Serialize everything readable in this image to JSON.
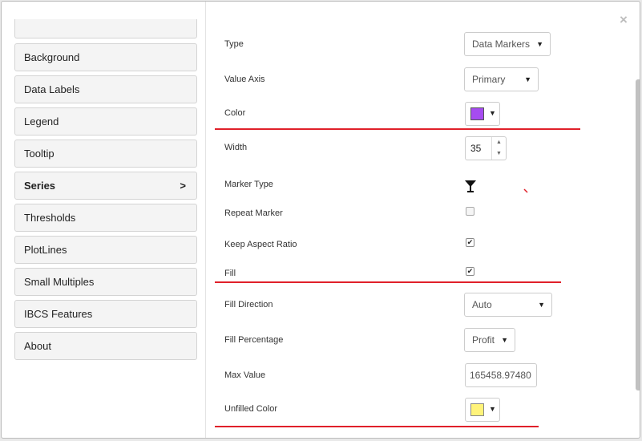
{
  "dialog": {
    "close_glyph": "×"
  },
  "sidebar": {
    "items": [
      {
        "label": "Background"
      },
      {
        "label": "Data Labels"
      },
      {
        "label": "Legend"
      },
      {
        "label": "Tooltip"
      },
      {
        "label": "Series",
        "active": true,
        "arrow": ">"
      },
      {
        "label": "Thresholds"
      },
      {
        "label": "PlotLines"
      },
      {
        "label": "Small Multiples"
      },
      {
        "label": "IBCS Features"
      },
      {
        "label": "About"
      }
    ]
  },
  "settings": {
    "type": {
      "label": "Type",
      "value": "Data Markers"
    },
    "value_axis": {
      "label": "Value Axis",
      "value": "Primary"
    },
    "color": {
      "label": "Color",
      "value": "#a64cf0"
    },
    "width": {
      "label": "Width",
      "value": "35"
    },
    "marker_type": {
      "label": "Marker Type",
      "icon": "funnel-marker-icon"
    },
    "repeat_marker": {
      "label": "Repeat Marker",
      "checked": false
    },
    "keep_aspect_ratio": {
      "label": "Keep Aspect Ratio",
      "checked": true
    },
    "fill": {
      "label": "Fill",
      "checked": true
    },
    "fill_direction": {
      "label": "Fill Direction",
      "value": "Auto"
    },
    "fill_percentage": {
      "label": "Fill Percentage",
      "value": "Profit"
    },
    "max_value": {
      "label": "Max Value",
      "value": "165458.97480"
    },
    "unfilled_color": {
      "label": "Unfilled Color",
      "value": "#fff37a"
    }
  },
  "glyphs": {
    "caret": "▼",
    "check": "✔",
    "spin_up": "▲",
    "spin_down": "▼"
  },
  "colors": {
    "annotation_red": "#e0202a",
    "swatch_purple": "#a64cf0",
    "swatch_yellow": "#fff37a"
  }
}
